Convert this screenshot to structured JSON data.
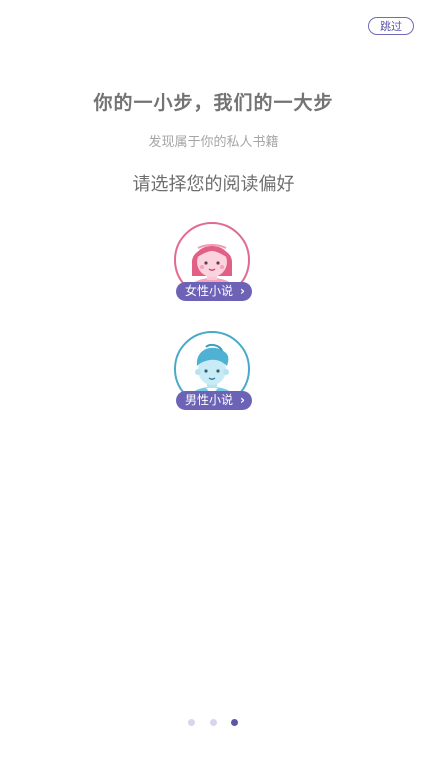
{
  "skip_label": "跳过",
  "headline": "你的一小步，我们的一大步",
  "subtitle": "发现属于你的私人书籍",
  "prompt": "请选择您的阅读偏好",
  "choices": [
    {
      "label": "女性小说",
      "icon": "girl-avatar-icon"
    },
    {
      "label": "男性小说",
      "icon": "boy-avatar-icon"
    }
  ],
  "pager": {
    "total": 3,
    "active": 3
  },
  "colors": {
    "accent": "#6c63b6",
    "female_ring": "#e36a8f",
    "male_ring": "#4aa9c9",
    "dot_inactive": "#d7d5ef",
    "dot_active": "#5b57a6"
  }
}
